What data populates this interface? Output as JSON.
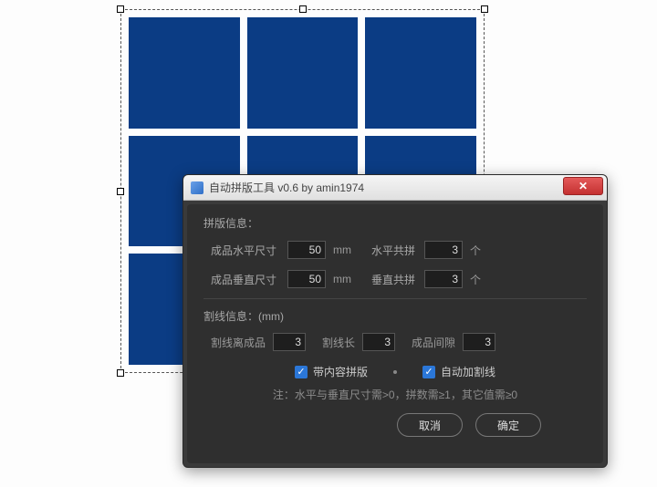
{
  "canvas": {
    "grid_rows": 3,
    "grid_cols": 3,
    "cell_color": "#0b3c84"
  },
  "dialog": {
    "title": "自动拼版工具 v0.6   by amin1974",
    "section_info": "拼版信息：",
    "horiz_size_label": "成品水平尺寸",
    "horiz_size_value": "50",
    "horiz_size_unit": "mm",
    "horiz_count_label": "水平共拼",
    "horiz_count_value": "3",
    "horiz_count_unit": "个",
    "vert_size_label": "成品垂直尺寸",
    "vert_size_value": "50",
    "vert_size_unit": "mm",
    "vert_count_label": "垂直共拼",
    "vert_count_value": "3",
    "vert_count_unit": "个",
    "cut_section": "割线信息：(mm)",
    "cut_dist_label": "割线离成品",
    "cut_dist_value": "3",
    "cut_len_label": "割线长",
    "cut_len_value": "3",
    "cut_gap_label": "成品间隙",
    "cut_gap_value": "3",
    "checkbox1_label": "带内容拼版",
    "checkbox1_checked": true,
    "checkbox2_label": "自动加割线",
    "checkbox2_checked": true,
    "note": "注：水平与垂直尺寸需>0，拼数需≥1，其它值需≥0",
    "cancel_label": "取消",
    "ok_label": "确定"
  }
}
